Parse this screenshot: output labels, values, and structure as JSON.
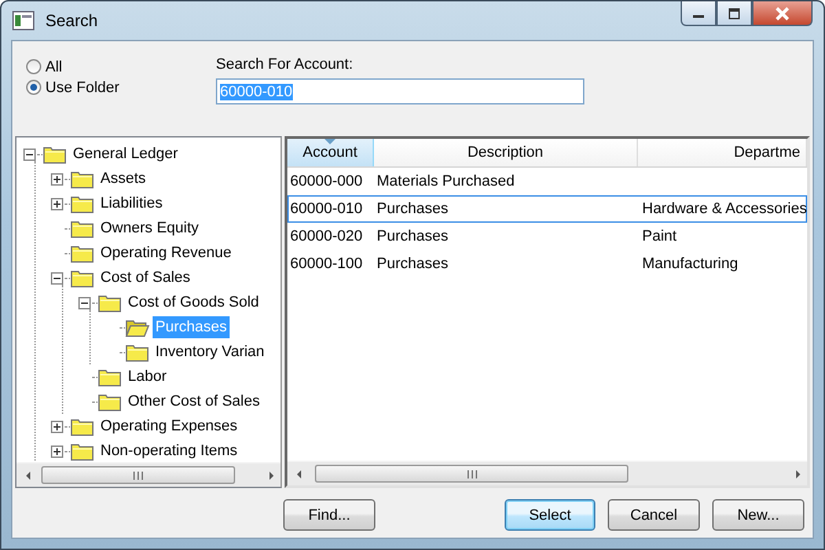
{
  "window": {
    "title": "Search"
  },
  "scope": [
    {
      "label": "All",
      "selected": false
    },
    {
      "label": "Use Folder",
      "selected": true
    }
  ],
  "search": {
    "label": "Search For Account:",
    "value": "60000-010"
  },
  "tree": [
    {
      "label": "General Ledger",
      "expanded": true,
      "selected": false,
      "children": [
        {
          "label": "Assets",
          "expanded": false,
          "selected": false
        },
        {
          "label": "Liabilities",
          "expanded": false,
          "selected": false
        },
        {
          "label": "Owners Equity",
          "selected": false
        },
        {
          "label": "Operating Revenue",
          "selected": false
        },
        {
          "label": "Cost of Sales",
          "expanded": true,
          "selected": false,
          "children": [
            {
              "label": "Cost of Goods Sold",
              "expanded": true,
              "selected": false,
              "children": [
                {
                  "label": "Purchases",
                  "selected": true
                },
                {
                  "label": "Inventory Varian",
                  "selected": false
                }
              ]
            },
            {
              "label": "Labor",
              "selected": false
            },
            {
              "label": "Other Cost of Sales",
              "selected": false
            }
          ]
        },
        {
          "label": "Operating Expenses",
          "expanded": false,
          "selected": false
        },
        {
          "label": "Non-operating Items",
          "expanded": false,
          "selected": false
        }
      ]
    }
  ],
  "table": {
    "columns": [
      {
        "label": "Account",
        "sorted": true
      },
      {
        "label": "Description",
        "sorted": false
      },
      {
        "label": "Departme",
        "sorted": false
      }
    ],
    "rows": [
      {
        "cells": [
          "60000-000",
          "Materials Purchased",
          ""
        ],
        "selected": false
      },
      {
        "cells": [
          "60000-010",
          "Purchases",
          "Hardware & Accessories"
        ],
        "selected": true
      },
      {
        "cells": [
          "60000-020",
          "Purchases",
          "Paint"
        ],
        "selected": false
      },
      {
        "cells": [
          "60000-100",
          "Purchases",
          "Manufacturing"
        ],
        "selected": false
      }
    ]
  },
  "buttons": [
    {
      "label": "Find...",
      "default": false
    },
    {
      "label": "Select",
      "default": true
    },
    {
      "label": "Cancel",
      "default": false
    },
    {
      "label": "New...",
      "default": false
    }
  ]
}
